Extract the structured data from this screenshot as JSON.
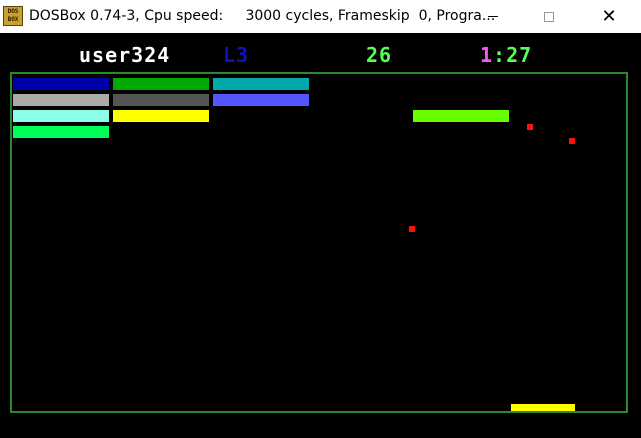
{
  "window": {
    "title": "DOSBox 0.74-3, Cpu speed:     3000 cycles, Frameskip  0, Progra...",
    "icon_label_top": "DOS",
    "icon_label_bottom": "BOX",
    "close_glyph": "✕"
  },
  "hud": {
    "user": "user324",
    "level": "L3",
    "score": "26",
    "time_minutes": "1",
    "time_seconds": ":27"
  },
  "colors": {
    "field_border": "#2a8a2a",
    "ball": "#ff1010",
    "paddle": "#ffff00"
  },
  "bricks": [
    {
      "color": "#0000aa"
    },
    {
      "color": "#00aa00"
    },
    {
      "color": "#00aaaa"
    },
    {
      "color": "#aaaaaa"
    },
    {
      "color": "#555555"
    },
    {
      "color": "#5555ff"
    },
    {
      "color": "#8cffe8"
    },
    {
      "color": "#ffff00"
    },
    {
      "color": "#66ff00"
    },
    {
      "color": "#00ff55"
    }
  ],
  "balls": 3
}
